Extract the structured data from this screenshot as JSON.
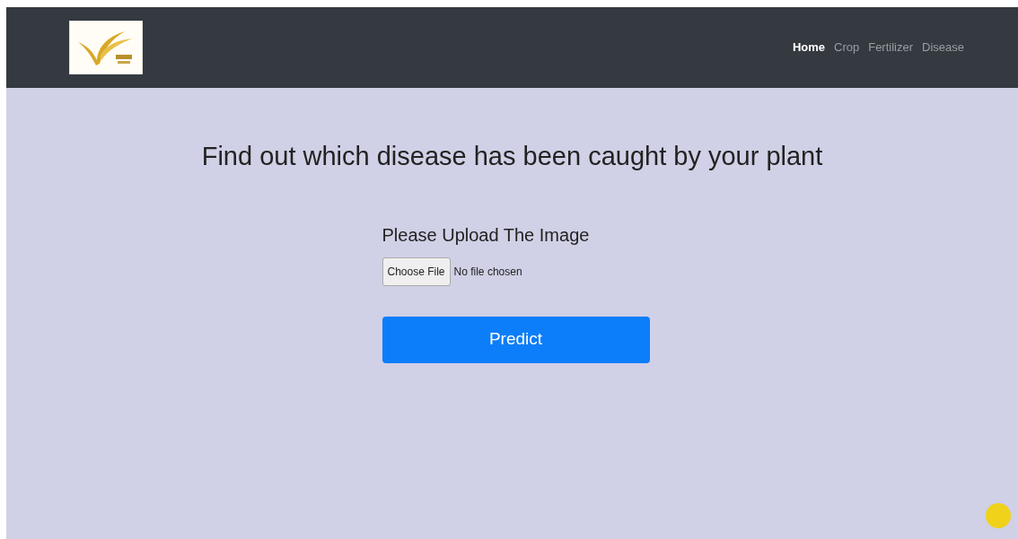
{
  "navbar": {
    "links": [
      {
        "label": "Home",
        "selected": true
      },
      {
        "label": "Crop",
        "selected": false
      },
      {
        "label": "Fertilizer",
        "selected": false
      },
      {
        "label": "Disease",
        "selected": false
      }
    ]
  },
  "heading": "Find out which disease has been caught by your plant",
  "upload": {
    "label": "Please Upload The Image",
    "button": "Choose File",
    "status": "No file chosen"
  },
  "submit": "Predict"
}
